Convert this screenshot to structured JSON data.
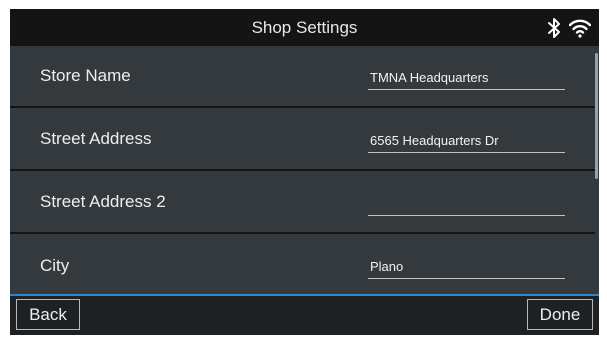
{
  "header": {
    "title": "Shop Settings",
    "icons": [
      "bluetooth-icon",
      "wifi-icon"
    ]
  },
  "fields": [
    {
      "label": "Store Name",
      "value": "TMNA Headquarters"
    },
    {
      "label": "Street Address",
      "value": "6565 Headquarters Dr"
    },
    {
      "label": "Street Address 2",
      "value": ""
    },
    {
      "label": "City",
      "value": "Plano"
    }
  ],
  "footer": {
    "back_label": "Back",
    "done_label": "Done"
  },
  "colors": {
    "background": "#34393d",
    "titlebar": "#141414",
    "accent": "#2f86d0"
  }
}
